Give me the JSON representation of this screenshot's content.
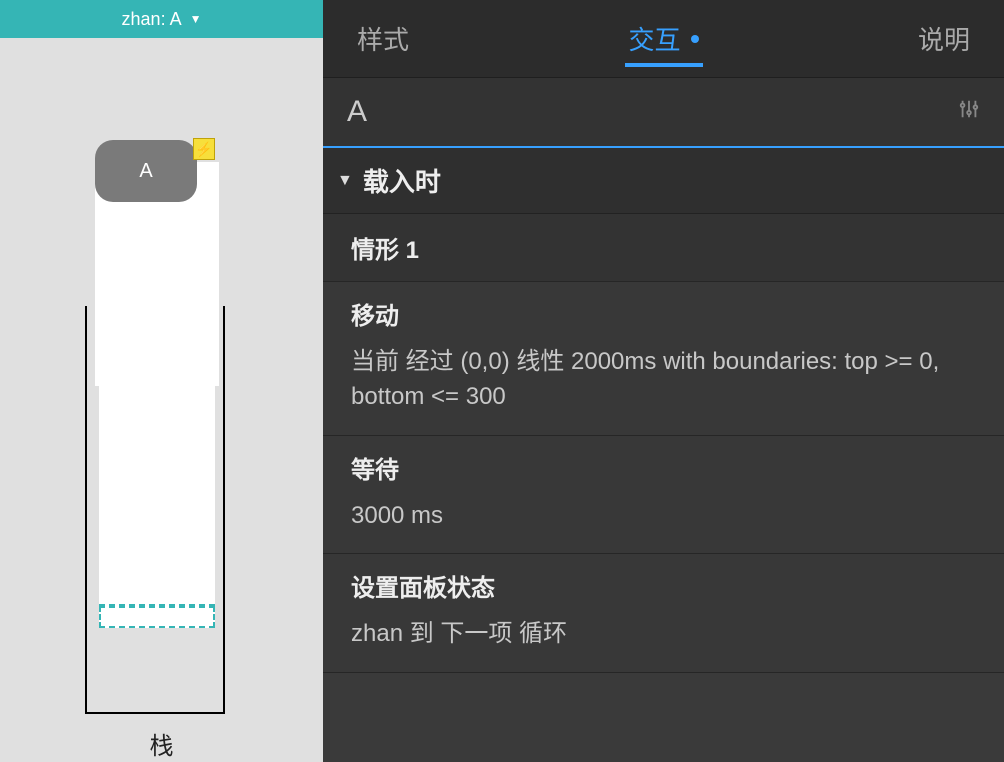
{
  "canvas": {
    "header_label": "zhan:  A",
    "pill_text": "A",
    "bolt_glyph": "⚡",
    "panel_label": "栈"
  },
  "tabs": {
    "style": "样式",
    "interaction": "交互",
    "notes": "说明"
  },
  "element": {
    "name": "A"
  },
  "event": {
    "title": "载入时",
    "case_label": "情形 1",
    "actions": [
      {
        "title": "移动",
        "detail": "当前 经过 (0,0) 线性 2000ms with boundaries: top >= 0, bottom <= 300"
      },
      {
        "title": "等待",
        "detail": "3000 ms"
      },
      {
        "title": "设置面板状态",
        "detail": "zhan 到 下一项 循环"
      }
    ]
  }
}
